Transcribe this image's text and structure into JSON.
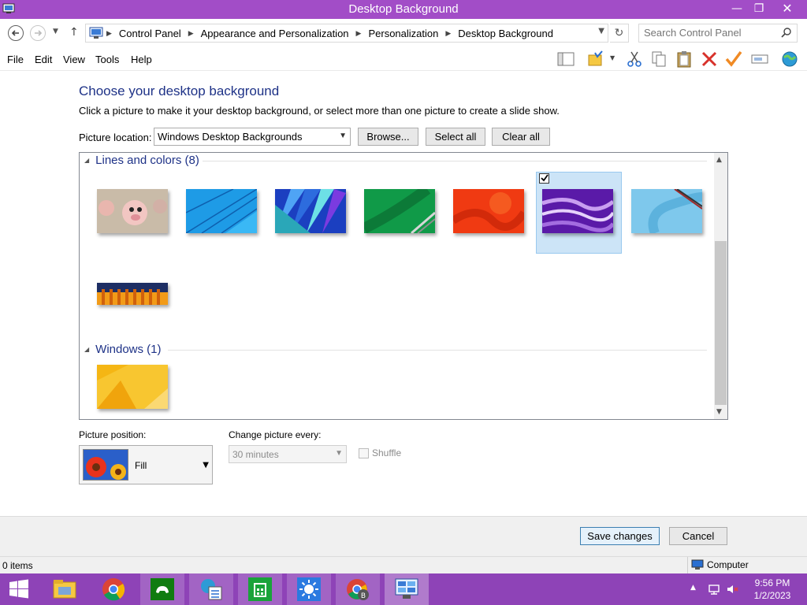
{
  "window": {
    "title": "Desktop Background",
    "controls": {
      "minimize": "—",
      "maximize": "❐",
      "close": "✕"
    }
  },
  "address": {
    "breadcrumbs": [
      "Control Panel",
      "Appearance and Personalization",
      "Personalization",
      "Desktop Background"
    ],
    "search_placeholder": "Search Control Panel"
  },
  "menu": {
    "file": "File",
    "edit": "Edit",
    "view": "View",
    "tools": "Tools",
    "help": "Help"
  },
  "toolbar_icons": [
    "layout-pane-icon",
    "folder-options-icon",
    "cut-icon",
    "copy-icon",
    "paste-icon",
    "delete-icon",
    "properties-check-icon",
    "rename-icon",
    "globe-icon"
  ],
  "main": {
    "heading": "Choose your desktop background",
    "description": "Click a picture to make it your desktop background, or select more than one picture to create a slide show.",
    "location_label": "Picture location:",
    "location_value": "Windows Desktop Backgrounds",
    "browse": "Browse...",
    "select_all": "Select all",
    "clear_all": "Clear all"
  },
  "groups": [
    {
      "title": "Lines and colors (8)",
      "pictures": [
        {
          "name": "cartoon-pig",
          "selected": false
        },
        {
          "name": "blue-lines",
          "selected": false
        },
        {
          "name": "blue-fan",
          "selected": false
        },
        {
          "name": "green-ribbons",
          "selected": false
        },
        {
          "name": "red-waves",
          "selected": false
        },
        {
          "name": "purple-waves",
          "selected": true
        },
        {
          "name": "light-blue-abstract",
          "selected": false
        },
        {
          "name": "orange-blocks",
          "selected": false
        }
      ]
    },
    {
      "title": "Windows (1)",
      "pictures": [
        {
          "name": "yellow-windows",
          "selected": false
        }
      ]
    }
  ],
  "position": {
    "label": "Picture position:",
    "value": "Fill",
    "interval_label": "Change picture every:",
    "interval_value": "30 minutes",
    "shuffle_label": "Shuffle",
    "shuffle_checked": false
  },
  "footer": {
    "save": "Save changes",
    "cancel": "Cancel"
  },
  "status": {
    "items": "0 items",
    "location": "Computer"
  },
  "taskbar": {
    "apps": [
      "start",
      "file-explorer",
      "chrome",
      "xbox-games",
      "task-manager",
      "store",
      "weather",
      "chrome-profile",
      "control-panel"
    ],
    "time": "9:56 PM",
    "date": "1/2/2023"
  },
  "colors": {
    "accent": "#a24dc7",
    "taskbar": "#8e43b7",
    "heading": "#1e3287",
    "selection": "#cce4f7"
  }
}
